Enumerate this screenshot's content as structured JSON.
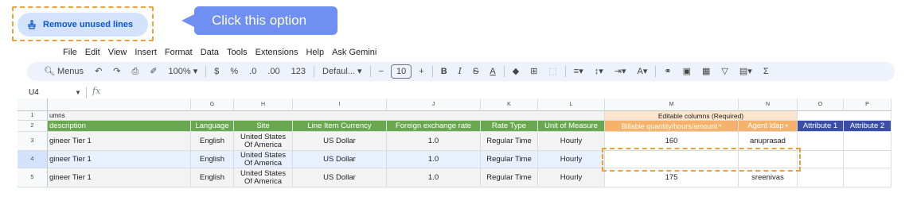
{
  "callout": {
    "button_label": "Remove unused lines",
    "tooltip": "Click this option",
    "highlight_color": "#e8a33a",
    "tooltip_color": "#6f8ff2"
  },
  "menu": [
    "File",
    "Edit",
    "View",
    "Insert",
    "Format",
    "Data",
    "Tools",
    "Extensions",
    "Help",
    "Ask Gemini"
  ],
  "toolbar": {
    "search": "Menus",
    "zoom": "100%",
    "currency": "$",
    "percent": "%",
    "dec_less": ".0",
    "dec_more": ".00",
    "number_format": "123",
    "font": "Defaul...",
    "font_size": "10"
  },
  "formula_bar": {
    "name_box": "U4",
    "fx": "fx"
  },
  "columns": [
    "G",
    "H",
    "I",
    "J",
    "K",
    "L",
    "M",
    "N",
    "O",
    "P"
  ],
  "rows": [
    "1",
    "2",
    "3",
    "4",
    "5"
  ],
  "row1": {
    "a": "umns",
    "editable": "Editable columns (Required)"
  },
  "headers": {
    "a": "description",
    "g": "Language",
    "h": "Site",
    "i": "Line Item Currency",
    "j": "Foreign exchange rate",
    "k": "Rate Type",
    "l": "Unit of Measure",
    "m": "Billable quantity/hours/amount",
    "n": "Agent ldap",
    "o": "Attribute 1",
    "p": "Attribute 2"
  },
  "data_rows": [
    {
      "a": "gineer Tier 1",
      "g": "English",
      "h1": "United States",
      "h2": "Of America",
      "i": "US Dollar",
      "j": "1.0",
      "k": "Regular Time",
      "l": "Hourly",
      "m": "160",
      "n": "anuprasad"
    },
    {
      "a": "gineer Tier 1",
      "g": "English",
      "h1": "United States",
      "h2": "Of America",
      "i": "US Dollar",
      "j": "1.0",
      "k": "Regular Time",
      "l": "Hourly",
      "m": "",
      "n": ""
    },
    {
      "a": "gineer Tier 1",
      "g": "English",
      "h1": "United States",
      "h2": "Of America",
      "i": "US Dollar",
      "j": "1.0",
      "k": "Regular Time",
      "l": "Hourly",
      "m": "175",
      "n": "sreenivas"
    }
  ]
}
